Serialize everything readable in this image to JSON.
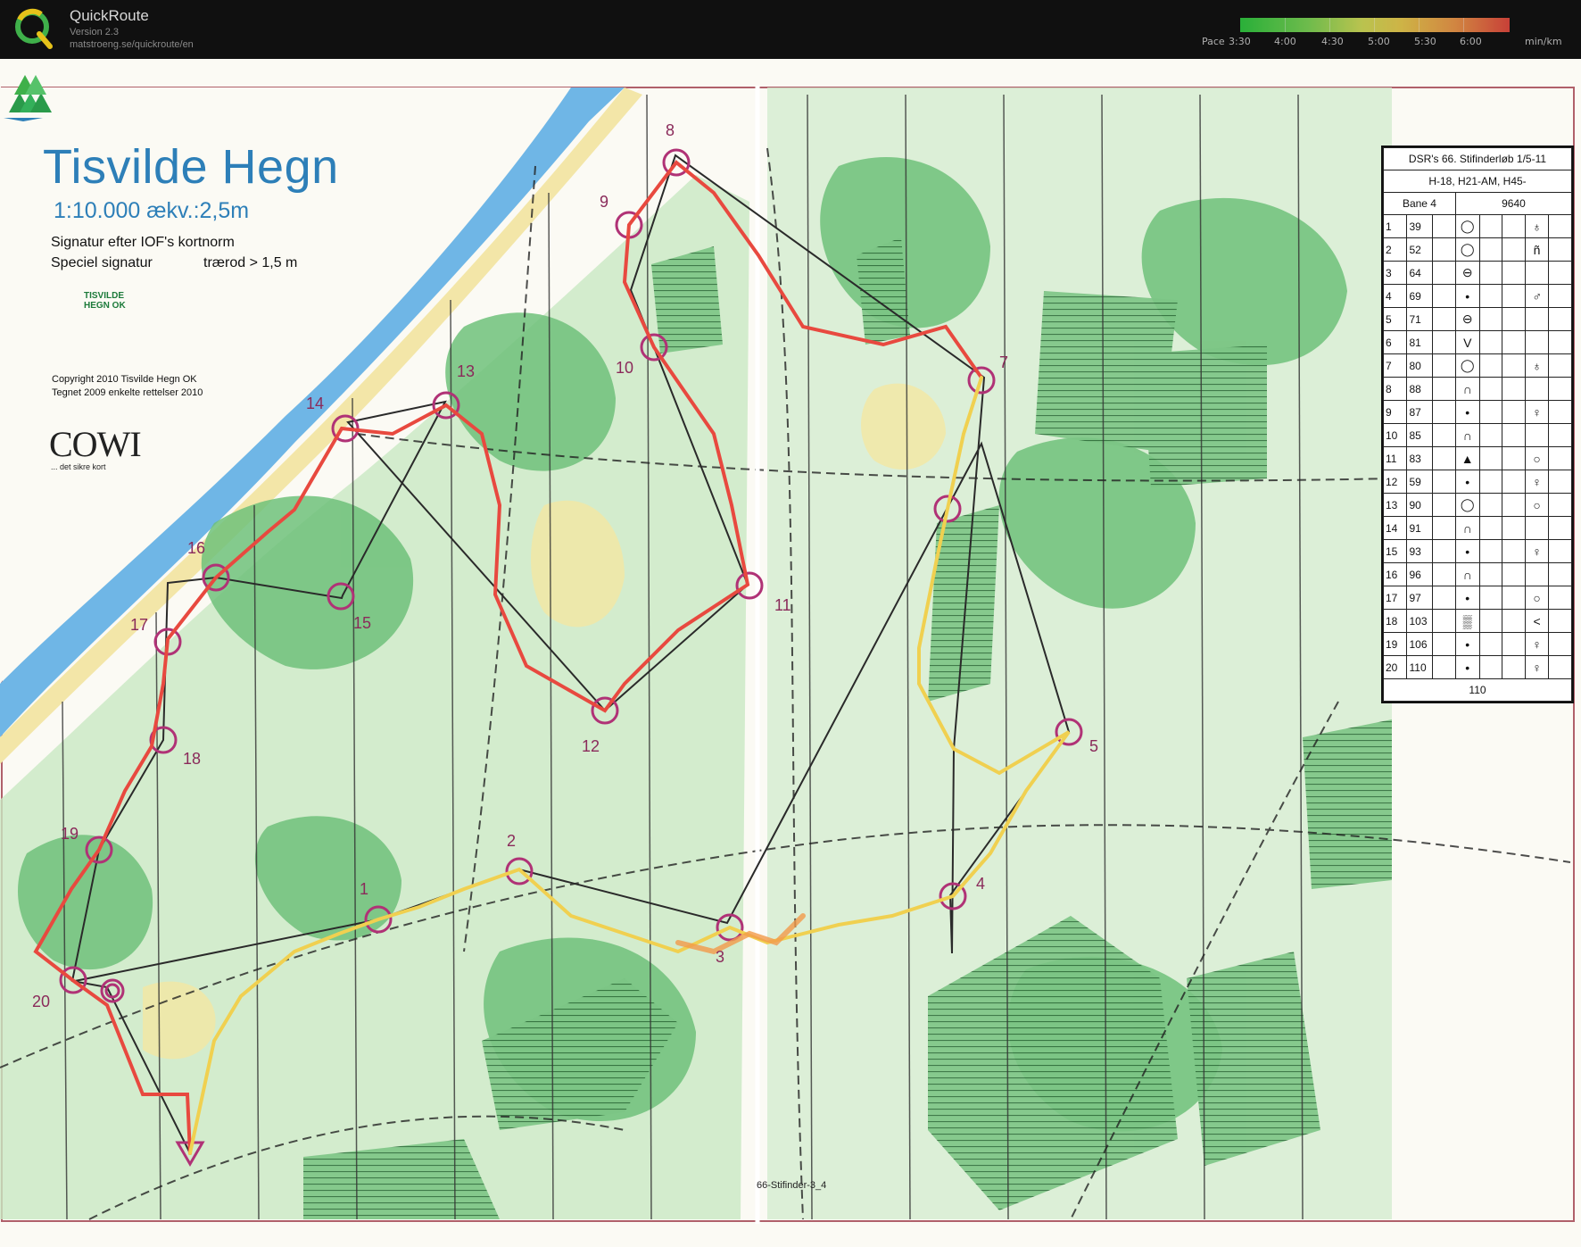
{
  "app": {
    "title": "QuickRoute",
    "version": "Version 2.3",
    "url": "matstroeng.se/quickroute/en"
  },
  "pace_legend": {
    "label_prefix": "Pace",
    "ticks": [
      "3:30",
      "4:00",
      "4:30",
      "5:00",
      "5:30",
      "6:00"
    ],
    "unit": "min/km"
  },
  "map": {
    "title": "Tisvilde Hegn",
    "scale": "1:10.000 ækv.:2,5m",
    "signature_line1": "Signatur efter IOF's kortnorm",
    "signature_line2": "Speciel signatur",
    "signature_line2b": "trærod > 1,5 m",
    "club_logo_text": "TISVILDE HEGN OK",
    "copyright_line1": "Copyright 2010 Tisvilde Hegn OK",
    "copyright_line2": "Tegnet 2009 enkelte rettelser 2010",
    "sponsor": "COWI",
    "sponsor_tagline": "... det sikre kort",
    "footer_code": "66-Stifinder-3_4",
    "colors": {
      "sea": "#6fb6e6",
      "forest": "#6fc17a",
      "course": "#b03276",
      "route": "#e8493f"
    }
  },
  "controls": [
    "1",
    "2",
    "3",
    "4",
    "5",
    "7",
    "8",
    "9",
    "10",
    "11",
    "12",
    "13",
    "14",
    "15",
    "16",
    "17",
    "18",
    "19",
    "20"
  ],
  "description_sheet": {
    "event": "DSR's 66. Stifinderløb 1/5-11",
    "classes": "H-18, H21-AM, H45-",
    "course": "Bane 4",
    "length": "9640",
    "rows": [
      {
        "n": "1",
        "code": "39",
        "feature": "◯",
        "detail": "♁"
      },
      {
        "n": "2",
        "code": "52",
        "feature": "◯",
        "detail": "ñ"
      },
      {
        "n": "3",
        "code": "64",
        "feature": "⊖",
        "detail": ""
      },
      {
        "n": "4",
        "code": "69",
        "feature": "•",
        "detail": "♂"
      },
      {
        "n": "5",
        "code": "71",
        "feature": "⊖",
        "detail": ""
      },
      {
        "n": "6",
        "code": "81",
        "feature": "V",
        "detail": ""
      },
      {
        "n": "7",
        "code": "80",
        "feature": "◯",
        "detail": "♁"
      },
      {
        "n": "8",
        "code": "88",
        "feature": "∩",
        "detail": ""
      },
      {
        "n": "9",
        "code": "87",
        "feature": "•",
        "detail": "♀"
      },
      {
        "n": "10",
        "code": "85",
        "feature": "∩",
        "detail": ""
      },
      {
        "n": "11",
        "code": "83",
        "feature": "▲",
        "detail": "○"
      },
      {
        "n": "12",
        "code": "59",
        "feature": "•",
        "detail": "♀"
      },
      {
        "n": "13",
        "code": "90",
        "feature": "◯",
        "detail": "○"
      },
      {
        "n": "14",
        "code": "91",
        "feature": "∩",
        "detail": ""
      },
      {
        "n": "15",
        "code": "93",
        "feature": "•",
        "detail": "♀"
      },
      {
        "n": "16",
        "code": "96",
        "feature": "∩",
        "detail": ""
      },
      {
        "n": "17",
        "code": "97",
        "feature": "•",
        "detail": "○"
      },
      {
        "n": "18",
        "code": "103",
        "feature": "▒",
        "detail": "<"
      },
      {
        "n": "19",
        "code": "106",
        "feature": "•",
        "detail": "♀"
      },
      {
        "n": "20",
        "code": "110",
        "feature": "•",
        "detail": "♀"
      }
    ],
    "finish_distance": "110"
  }
}
